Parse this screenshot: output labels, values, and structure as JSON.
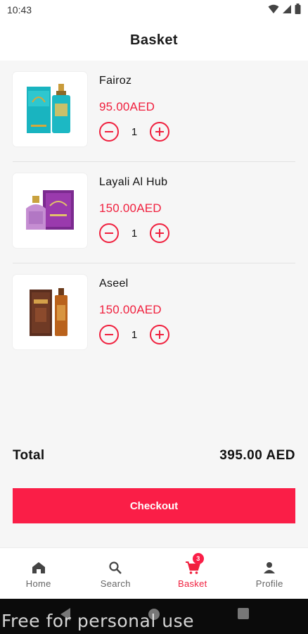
{
  "status_bar": {
    "time": "10:43"
  },
  "header": {
    "title": "Basket"
  },
  "items": [
    {
      "name": "Fairoz",
      "price": "95.00AED",
      "quantity": "1",
      "image_icon": "fairoz-perfume-image"
    },
    {
      "name": "Layali Al Hub",
      "price": "150.00AED",
      "quantity": "1",
      "image_icon": "layali-al-hub-perfume-image"
    },
    {
      "name": "Aseel",
      "price": "150.00AED",
      "quantity": "1",
      "image_icon": "aseel-perfume-image"
    }
  ],
  "summary": {
    "total_label": "Total",
    "total_value": "395.00 AED"
  },
  "checkout": {
    "label": "Checkout"
  },
  "nav": {
    "items": [
      {
        "label": "Home",
        "icon": "home-icon"
      },
      {
        "label": "Search",
        "icon": "search-icon"
      },
      {
        "label": "Basket",
        "icon": "cart-icon",
        "badge": "3",
        "active": true
      },
      {
        "label": "Profile",
        "icon": "person-icon"
      }
    ]
  },
  "watermark": {
    "text": "Free for personal use"
  },
  "colors": {
    "accent": "#f0203e",
    "button": "#fa1e47",
    "background": "#f6f6f6"
  }
}
